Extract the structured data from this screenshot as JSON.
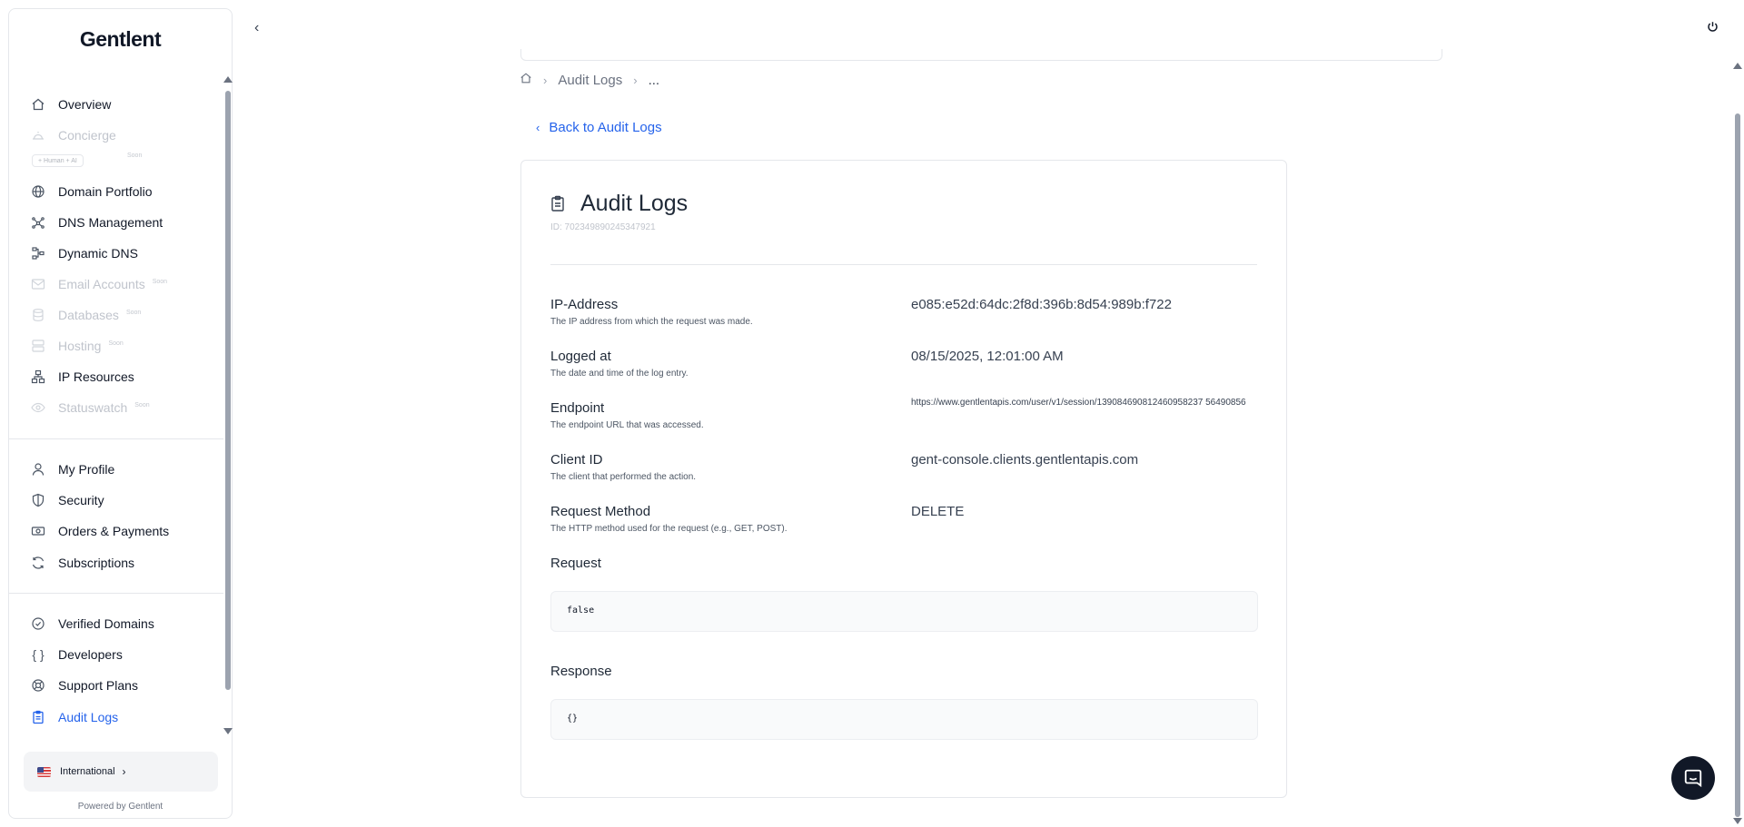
{
  "brand": {
    "name": "entlent",
    "initial": "G",
    "powered_by": "Powered by Gentlent"
  },
  "sidebar": {
    "items": [
      {
        "label": "Overview",
        "icon": "home-icon"
      },
      {
        "label": "Concierge",
        "icon": "bell-icon",
        "badge": "+ Human + AI",
        "soon": "Soon"
      },
      {
        "label": "Domain Portfolio",
        "icon": "globe-icon"
      },
      {
        "label": "DNS Management",
        "icon": "network-icon"
      },
      {
        "label": "Dynamic DNS",
        "icon": "flow-icon"
      },
      {
        "label": "Email Accounts",
        "icon": "mail-icon",
        "soon": "Soon"
      },
      {
        "label": "Databases",
        "icon": "database-icon",
        "soon": "Soon"
      },
      {
        "label": "Hosting",
        "icon": "server-icon",
        "soon": "Soon"
      },
      {
        "label": "IP Resources",
        "icon": "sitemap-icon"
      },
      {
        "label": "Statuswatch",
        "icon": "eye-icon",
        "soon": "Soon"
      },
      {
        "label": "My Profile",
        "icon": "user-icon"
      },
      {
        "label": "Security",
        "icon": "shield-icon"
      },
      {
        "label": "Orders & Payments",
        "icon": "money-icon"
      },
      {
        "label": "Subscriptions",
        "icon": "refresh-icon"
      },
      {
        "label": "Verified Domains",
        "icon": "check-circle-icon"
      },
      {
        "label": "Developers",
        "icon": "braces-icon"
      },
      {
        "label": "Support Plans",
        "icon": "lifebuoy-icon"
      },
      {
        "label": "Audit Logs",
        "icon": "clipboard-icon"
      }
    ],
    "region": {
      "label": "International",
      "flag": "us-flag-icon"
    }
  },
  "breadcrumb": {
    "home_icon": "home-icon",
    "items": [
      "Audit Logs",
      "..."
    ]
  },
  "back_link": {
    "label": "Back to Audit Logs"
  },
  "detail": {
    "title": "Audit Logs",
    "id": "ID: 702349890245347921",
    "rows": [
      {
        "label": "IP-Address",
        "desc": "The IP address from which the request was made.",
        "value": "e085:e52d:64dc:2f8d:396b:8d54:989b:f722"
      },
      {
        "label": "Logged at",
        "desc": "The date and time of the log entry.",
        "value": "08/15/2025, 12:01:00 AM"
      },
      {
        "label": "Endpoint",
        "desc": "The endpoint URL that was accessed.",
        "value": "https://www.gentlentapis.com/user/v1/session/139084690812460958237 56490856"
      },
      {
        "label": "Client ID",
        "desc": "The client that performed the action.",
        "value": "gent-console.clients.gentlentapis.com"
      },
      {
        "label": "Request Method",
        "desc": "The HTTP method used for the request (e.g., GET, POST).",
        "value": "DELETE"
      }
    ],
    "request": {
      "label": "Request",
      "value": "false"
    },
    "response": {
      "label": "Response",
      "value": "{}"
    }
  },
  "colors": {
    "accent": "#2563eb",
    "text": "#1f2937",
    "muted": "#6b7280",
    "disabled": "#c0c4cc"
  }
}
